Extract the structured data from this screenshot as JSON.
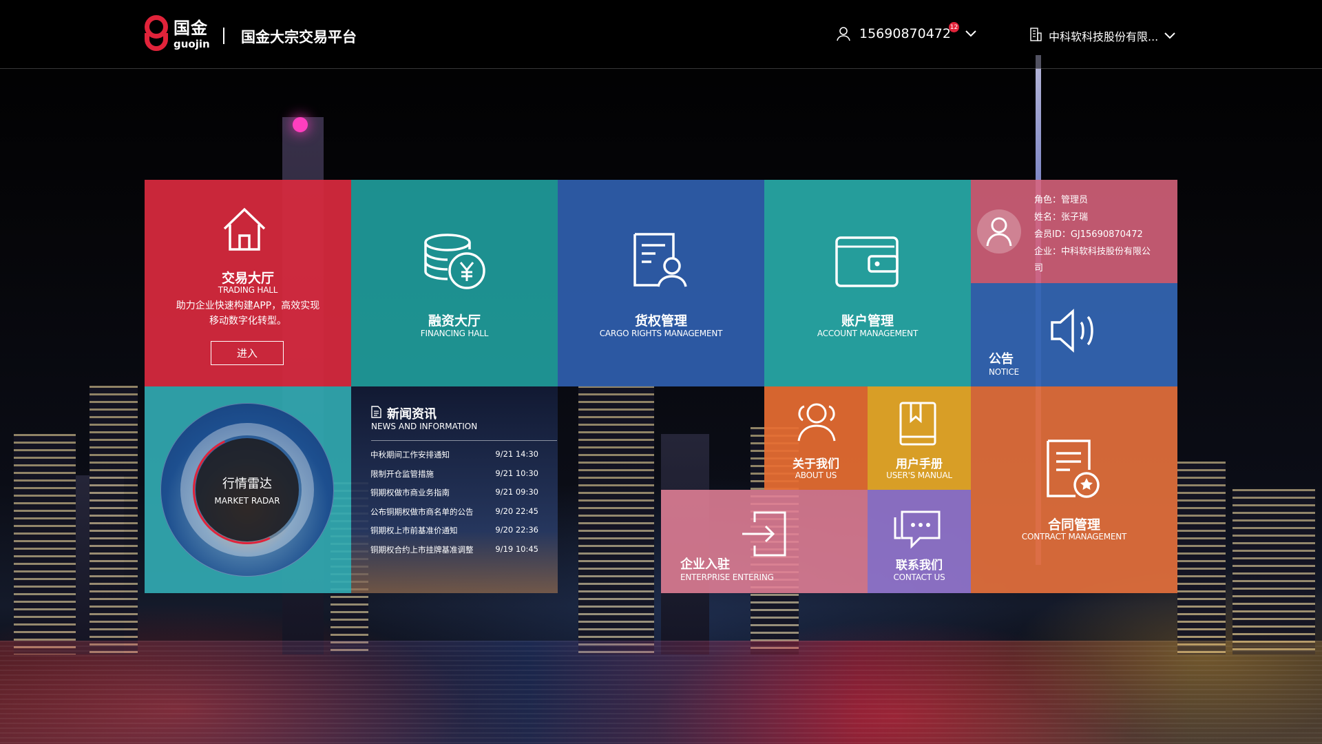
{
  "header": {
    "logo_cn": "国金",
    "logo_en": "guojin",
    "platform_name": "国金大宗交易平台",
    "user_phone": "15690870472",
    "notification_count": "12",
    "company_name": "中科软科技股份有限..."
  },
  "tiles": {
    "trading_hall": {
      "title_cn": "交易大厅",
      "title_en": "TRADING HALL",
      "desc": "助力企业快速构建APP，高效实现移动数字化转型。",
      "button": "进入"
    },
    "financing_hall": {
      "title_cn": "融资大厅",
      "title_en": "FINANCING HALL"
    },
    "cargo_rights": {
      "title_cn": "货权管理",
      "title_en": "CARGO RIGHTS MANAGEMENT"
    },
    "account": {
      "title_cn": "账户管理",
      "title_en": "ACCOUNT MANAGEMENT"
    },
    "profile": {
      "role": "角色：管理员",
      "name": "姓名：张子瑞",
      "member_id": "会员ID：GJ15690870472",
      "company_line1": "企业：中科软科技股份有限公",
      "company_line2": "司"
    },
    "notice": {
      "title_cn": "公告",
      "title_en": "NOTICE"
    },
    "market_radar": {
      "title_cn": "行情雷达",
      "title_en": "MARKET RADAR"
    },
    "news": {
      "title_cn": "新闻资讯",
      "title_en": "NEWS AND INFORMATION",
      "items": [
        {
          "title": "中秋期间工作安排通知",
          "time": "9/21  14:30"
        },
        {
          "title": "限制开仓监管措施",
          "time": "9/21  10:30"
        },
        {
          "title": "铜期权做市商业务指南",
          "time": "9/21  09:30"
        },
        {
          "title": "公布铜期权做市商名单的公告",
          "time": "9/20  22:45"
        },
        {
          "title": "铜期权上市前基准价通知",
          "time": "9/20  22:36"
        },
        {
          "title": "铜期权合约上市挂牌基准调整",
          "time": "9/19  10:45"
        }
      ]
    },
    "about": {
      "title_cn": "关于我们",
      "title_en": "ABOUT US"
    },
    "manual": {
      "title_cn": "用户手册",
      "title_en": "USER'S MANUAL"
    },
    "contract": {
      "title_cn": "合同管理",
      "title_en": "CONTRACT MANAGEMENT"
    },
    "enterprise": {
      "title_cn": "企业入驻",
      "title_en": "ENTERPRISE ENTERING"
    },
    "contact": {
      "title_cn": "联系我们",
      "title_en": "CONTACT US"
    }
  },
  "colors": {
    "brand_red": "#e1233a",
    "tile_red": "#d82a3e",
    "tile_teal": "#21a4a3",
    "tile_blue": "#305faf",
    "tile_pink": "#da647d",
    "tile_orange": "#e86e32",
    "tile_yellow": "#e8aa28",
    "tile_purple": "#9678d2"
  }
}
